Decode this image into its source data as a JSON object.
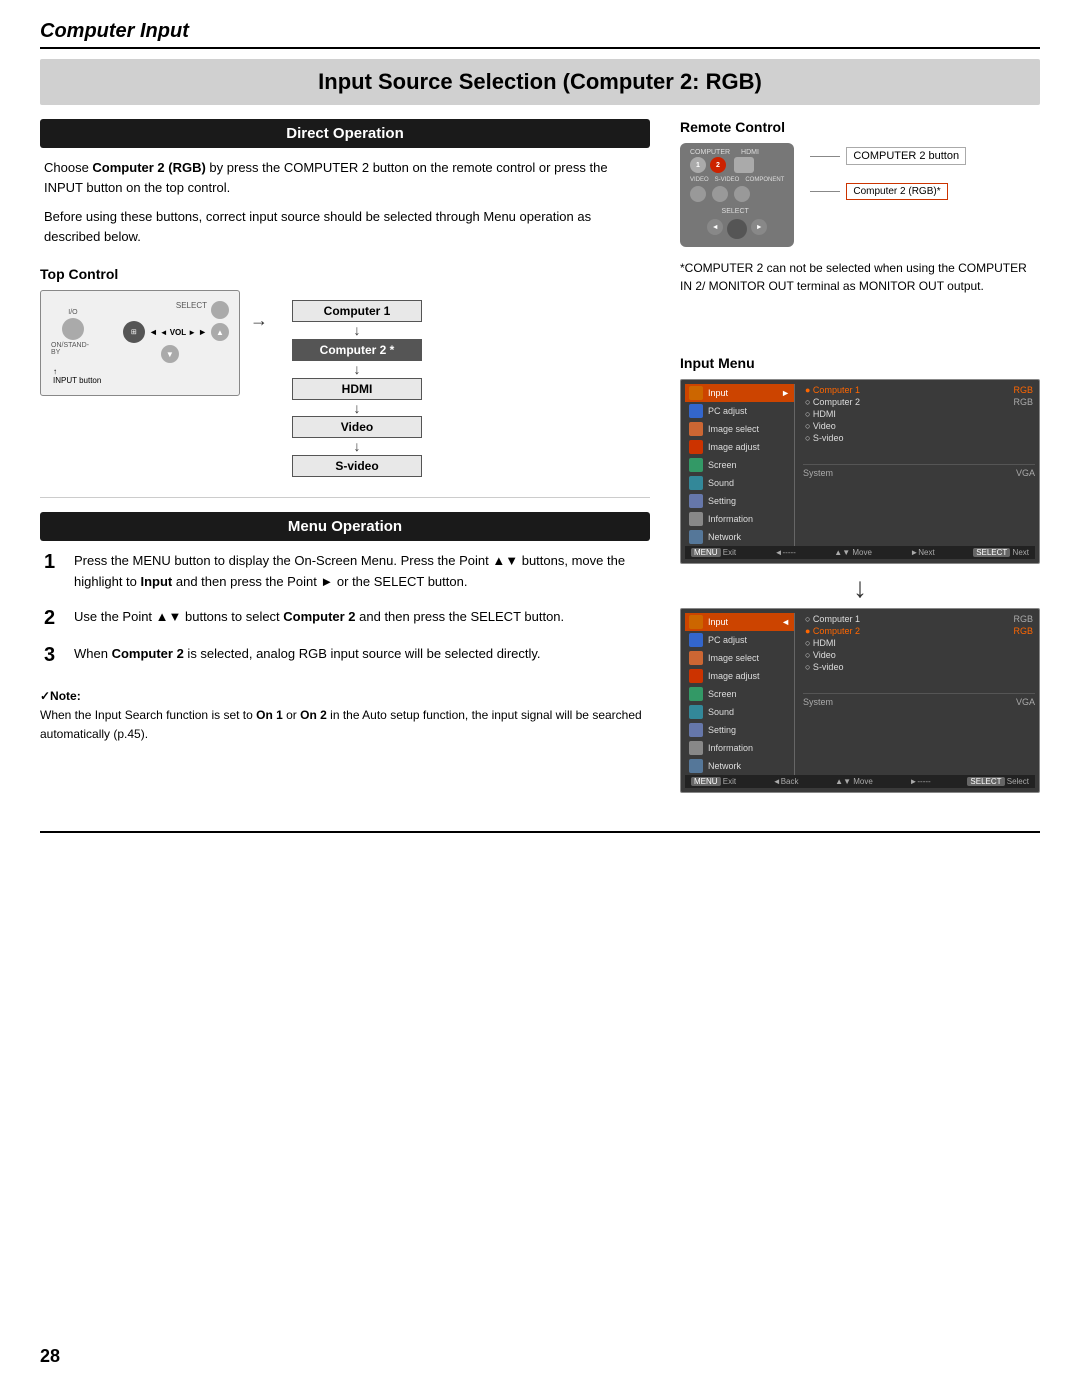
{
  "page": {
    "number": "28",
    "header_title": "Computer Input",
    "main_title": "Input Source Selection (Computer 2: RGB)"
  },
  "direct_operation": {
    "section_title": "Direct Operation",
    "paragraph1": "Choose Computer 2 (RGB) by press the COMPUTER 2 button on the remote control or press the INPUT button on the top control.",
    "paragraph1_bold": "Computer 2 (RGB)",
    "paragraph2": "Before using these buttons, correct input source should be selected through Menu operation as described below.",
    "top_control_label": "Top Control",
    "input_button_label": "INPUT button",
    "flow_items": [
      "Computer 1",
      "Computer 2 *",
      "HDMI",
      "Video",
      "S-video"
    ],
    "flow_highlighted_index": 1,
    "remote_control_label": "Remote Control",
    "computer2_button_label": "COMPUTER 2 button",
    "computer2_rgb_label": "Computer 2 (RGB)*",
    "note_computer2": "*COMPUTER 2 can not be selected when using the COMPUTER IN 2/ MONITOR OUT terminal as MONITOR OUT output."
  },
  "menu_operation": {
    "section_title": "Menu Operation",
    "input_menu_label": "Input Menu",
    "steps": [
      {
        "num": "1",
        "text": "Press the MENU button to display the On-Screen Menu. Press the Point ▲▼ buttons, move the highlight to Input and then press the Point ► or the SELECT button."
      },
      {
        "num": "2",
        "text": "Use the Point ▲▼ buttons to select Computer 2 and then press the SELECT button.",
        "bold_phrase": "Computer 2"
      },
      {
        "num": "3",
        "text": "When Computer 2 is selected, analog RGB input source will be selected directly.",
        "bold_phrase": "Computer 2"
      }
    ],
    "menu1": {
      "items": [
        "Input",
        "PC adjust",
        "Image select",
        "Image adjust",
        "Screen",
        "Sound",
        "Setting",
        "Information",
        "Network"
      ],
      "options": [
        "Computer 1",
        "Computer 2",
        "HDMI",
        "Video",
        "S-video"
      ],
      "active_item": "Input",
      "selected_option": "Computer 1",
      "system_label": "System",
      "vga_label": "VGA",
      "rgb_labels": [
        "RGB",
        "RGB"
      ],
      "footer": [
        "MENU Exit",
        "◄-----",
        "▲▼ Move",
        "►Next",
        "SELECT Next"
      ]
    },
    "menu2": {
      "items": [
        "Input",
        "PC adjust",
        "Image select",
        "Image adjust",
        "Screen",
        "Sound",
        "Setting",
        "Information",
        "Network"
      ],
      "options": [
        "Computer 1",
        "Computer 2",
        "HDMI",
        "Video",
        "S-video"
      ],
      "active_item": "Input",
      "selected_option": "Computer 2",
      "system_label": "System",
      "vga_label": "VGA",
      "footer": [
        "MENU Exit",
        "◄Back",
        "▲▼ Move",
        "►-----",
        "SELECT Select"
      ]
    }
  },
  "note": {
    "title": "✓Note:",
    "text": "When the Input Search function is set to On 1 or On 2 in the Auto setup function, the input signal will be searched automatically (p.45).",
    "bold_phrases": [
      "On 1",
      "On 2"
    ]
  }
}
